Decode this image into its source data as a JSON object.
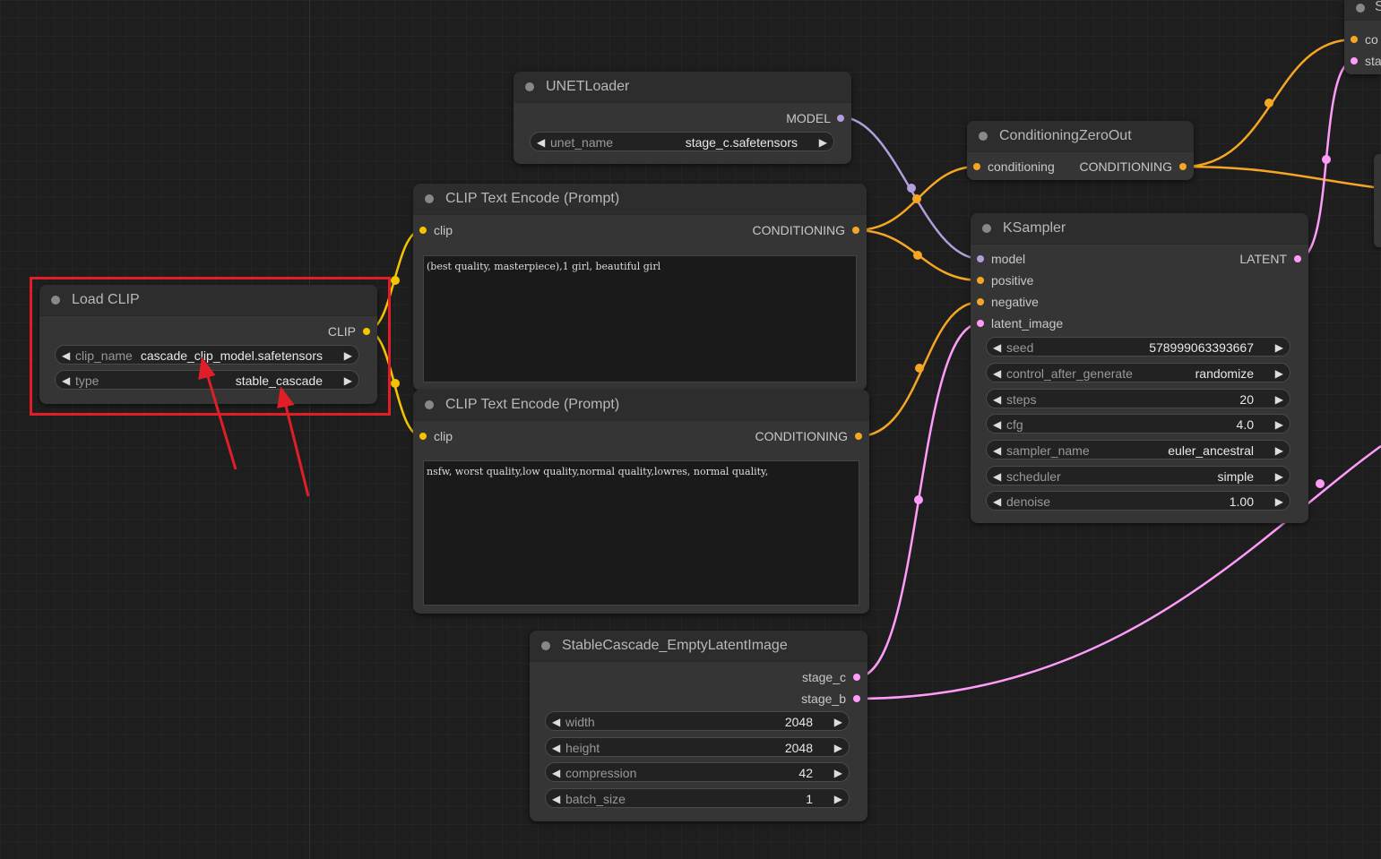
{
  "colors": {
    "clip": "#f5c400",
    "conditioning": "#f5a623",
    "model": "#b39ddb",
    "latent": "#ff9cf9",
    "highlight": "#e01e28",
    "annotation": "#e01e28"
  },
  "load_clip": {
    "title": "Load CLIP",
    "output": "CLIP",
    "clip_name_label": "clip_name",
    "clip_name_value": "cascade_clip_model.safetensors",
    "type_label": "type",
    "type_value": "stable_cascade"
  },
  "unet_loader": {
    "title": "UNETLoader",
    "output": "MODEL",
    "unet_name_label": "unet_name",
    "unet_name_value": "stage_c.safetensors"
  },
  "clip_text_pos": {
    "title": "CLIP Text Encode (Prompt)",
    "input": "clip",
    "output": "CONDITIONING",
    "text": "(best quality, masterpiece),1 girl, beautiful girl"
  },
  "clip_text_neg": {
    "title": "CLIP Text Encode (Prompt)",
    "input": "clip",
    "output": "CONDITIONING",
    "text": "nsfw, worst quality,low quality,normal quality,lowres, normal quality,"
  },
  "cond_zero_out": {
    "title": "ConditioningZeroOut",
    "input": "conditioning",
    "output": "CONDITIONING"
  },
  "ksampler": {
    "title": "KSampler",
    "inputs": [
      "model",
      "positive",
      "negative",
      "latent_image"
    ],
    "output": "LATENT",
    "widgets": [
      {
        "label": "seed",
        "value": "578999063393667"
      },
      {
        "label": "control_after_generate",
        "value": "randomize"
      },
      {
        "label": "steps",
        "value": "20"
      },
      {
        "label": "cfg",
        "value": "4.0"
      },
      {
        "label": "sampler_name",
        "value": "euler_ancestral"
      },
      {
        "label": "scheduler",
        "value": "simple"
      },
      {
        "label": "denoise",
        "value": "1.00"
      }
    ]
  },
  "empty_latent": {
    "title": "StableCascade_EmptyLatentImage",
    "outputs": [
      "stage_c",
      "stage_b"
    ],
    "widgets": [
      {
        "label": "width",
        "value": "2048"
      },
      {
        "label": "height",
        "value": "2048"
      },
      {
        "label": "compression",
        "value": "42"
      },
      {
        "label": "batch_size",
        "value": "1"
      }
    ]
  },
  "offscreen_node": {
    "title_fragment": "S",
    "slot1": "co",
    "slot2": "sta"
  },
  "glyphs": {
    "left_arrow": "◀",
    "right_arrow": "▶"
  }
}
